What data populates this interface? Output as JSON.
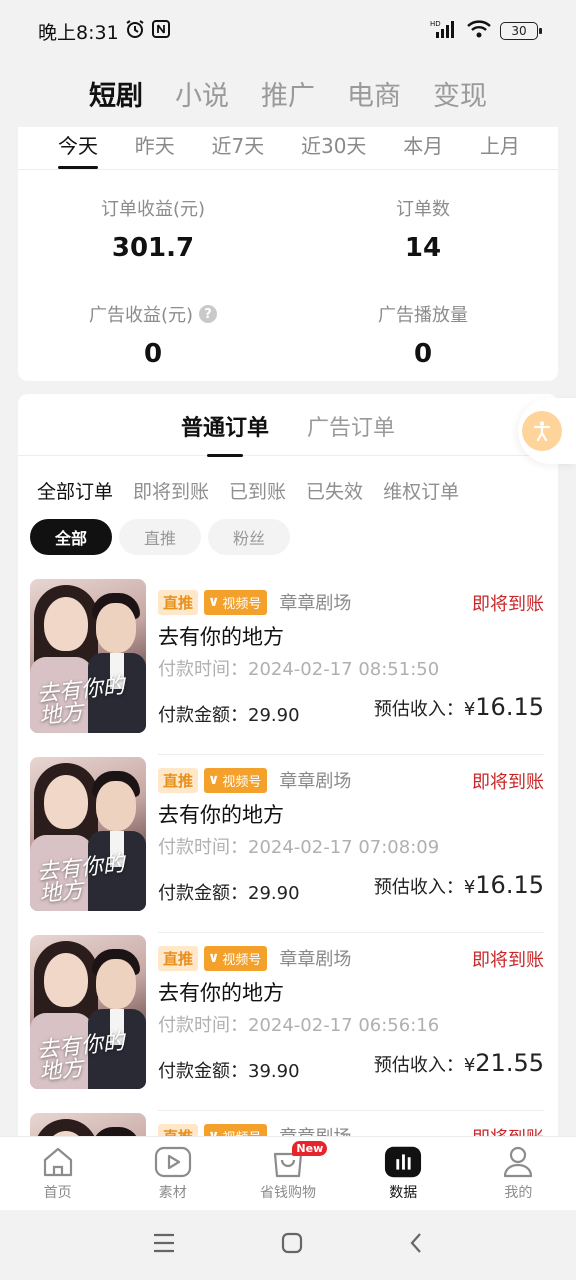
{
  "status_bar": {
    "time": "晚上8:31",
    "battery": "30"
  },
  "top_tabs": [
    "短剧",
    "小说",
    "推广",
    "电商",
    "变现"
  ],
  "date_tabs": [
    "今天",
    "昨天",
    "近7天",
    "近30天",
    "本月",
    "上月"
  ],
  "stats": {
    "order_income_label": "订单收益(元)",
    "order_income_value": "301.7",
    "order_count_label": "订单数",
    "order_count_value": "14",
    "ad_income_label": "广告收益(元)",
    "ad_income_value": "0",
    "ad_plays_label": "广告播放量",
    "ad_plays_value": "0"
  },
  "order_type_tabs": [
    "普通订单",
    "广告订单"
  ],
  "status_tabs": [
    "全部订单",
    "即将到账",
    "已到账",
    "已失效",
    "维权订单"
  ],
  "filter_chips": [
    "全部",
    "直推",
    "粉丝"
  ],
  "orders": [
    {
      "badge": "直推",
      "channel": "视频号",
      "source": "章章剧场",
      "state": "即将到账",
      "title": "去有你的地方",
      "pay_time": "付款时间：2024-02-17 08:51:50",
      "amount_label": "付款金额：",
      "amount": "29.90",
      "income_label": "预估收入：",
      "income_symbol": "¥",
      "income": "16.15",
      "poster_text": "去有你的地方"
    },
    {
      "badge": "直推",
      "channel": "视频号",
      "source": "章章剧场",
      "state": "即将到账",
      "title": "去有你的地方",
      "pay_time": "付款时间：2024-02-17 07:08:09",
      "amount_label": "付款金额：",
      "amount": "29.90",
      "income_label": "预估收入：",
      "income_symbol": "¥",
      "income": "16.15",
      "poster_text": "去有你的地方"
    },
    {
      "badge": "直推",
      "channel": "视频号",
      "source": "章章剧场",
      "state": "即将到账",
      "title": "去有你的地方",
      "pay_time": "付款时间：2024-02-17 06:56:16",
      "amount_label": "付款金额：",
      "amount": "39.90",
      "income_label": "预估收入：",
      "income_symbol": "¥",
      "income": "21.55",
      "poster_text": "去有你的地方"
    },
    {
      "badge": "直推",
      "channel": "视频号",
      "source": "章章剧场",
      "state": "即将到账",
      "title": "",
      "pay_time": "",
      "amount_label": "",
      "amount": "",
      "income_label": "",
      "income_symbol": "",
      "income": "",
      "poster_text": ""
    }
  ],
  "bottom_nav": [
    {
      "label": "首页",
      "icon": "home-icon"
    },
    {
      "label": "素材",
      "icon": "play-icon"
    },
    {
      "label": "省钱购物",
      "icon": "shopping-bag-icon",
      "badge": "New"
    },
    {
      "label": "数据",
      "icon": "bar-chart-icon"
    },
    {
      "label": "我的",
      "icon": "person-icon"
    }
  ],
  "colors": {
    "accent_red": "#c9282a",
    "badge_orange": "#f4a12c",
    "new_badge": "#e6242b"
  }
}
